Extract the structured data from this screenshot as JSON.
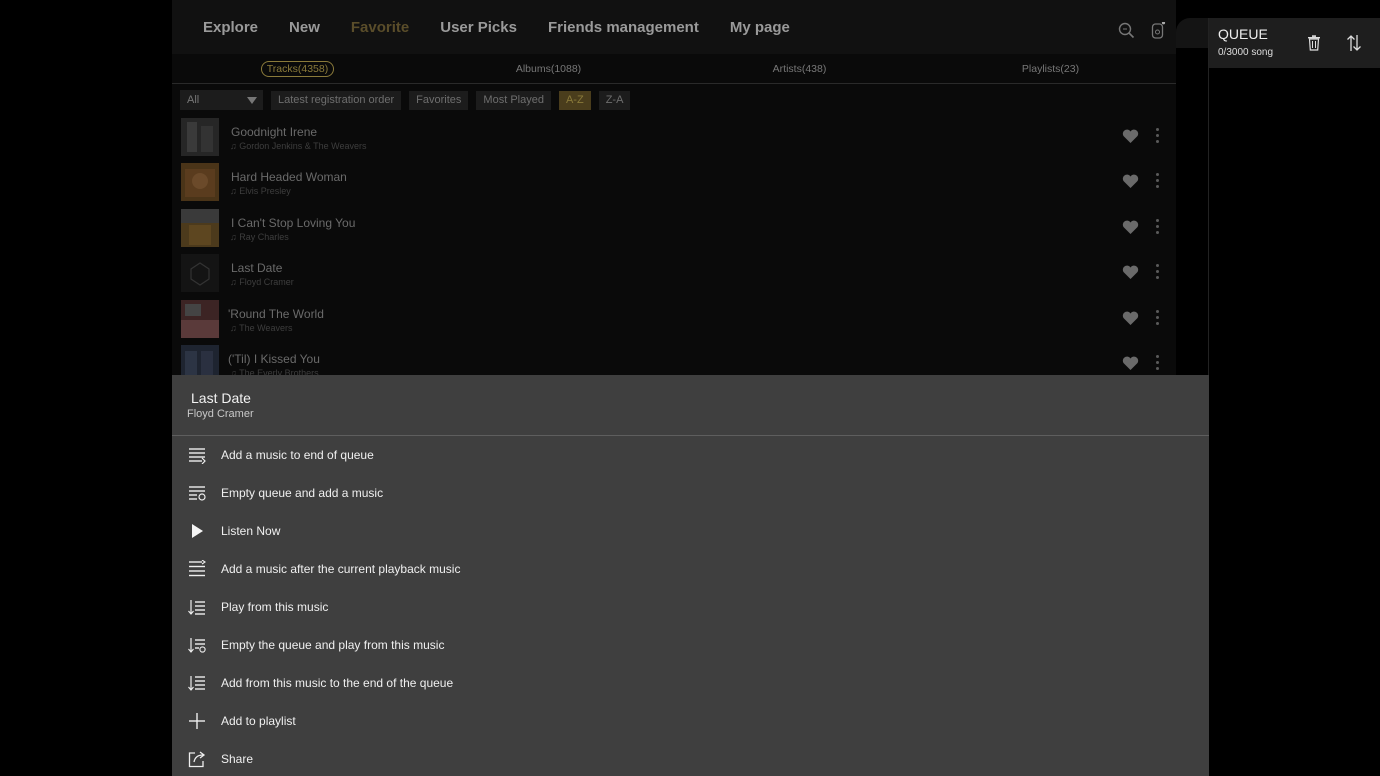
{
  "nav": {
    "items": [
      "Explore",
      "New",
      "Favorite",
      "User Picks",
      "Friends management",
      "My page"
    ],
    "active": "Favorite",
    "icons": [
      "search-icon",
      "device-icon"
    ]
  },
  "subtabs": [
    "Tracks(4358)",
    "Albums(1088)",
    "Artists(438)",
    "Playlists(23)"
  ],
  "filters": {
    "select_value": "All",
    "buttons": [
      "Latest registration order",
      "Favorites",
      "Most Played",
      "A-Z",
      "Z-A"
    ],
    "active": "A-Z"
  },
  "tracks": [
    {
      "title": "Goodnight Irene",
      "artist": "Gordon Jenkins & The Weavers"
    },
    {
      "title": "Hard Headed Woman",
      "artist": "Elvis Presley"
    },
    {
      "title": "I Can't Stop Loving You",
      "artist": "Ray Charles"
    },
    {
      "title": "Last Date",
      "artist": "Floyd Cramer"
    },
    {
      "title": "'Round The World",
      "artist": "The Weavers"
    },
    {
      "title": "('Til) I Kissed You",
      "artist": "The Everly Brothers"
    }
  ],
  "queue": {
    "title": "QUEUE",
    "count": "0/3000 song"
  },
  "sheet": {
    "title": "Last Date",
    "artist": "Floyd Cramer",
    "items": [
      {
        "label": "Add a music to end of queue",
        "icon": "queue-add-end-icon"
      },
      {
        "label": "Empty queue and add a music",
        "icon": "queue-empty-add-icon"
      },
      {
        "label": "Listen Now",
        "icon": "play-icon"
      },
      {
        "label": "Add a music after the current playback music",
        "icon": "queue-insert-next-icon"
      },
      {
        "label": "Play from this music",
        "icon": "play-from-icon"
      },
      {
        "label": "Empty the queue and play from this music",
        "icon": "empty-play-from-icon"
      },
      {
        "label": "Add from this music to the end of the queue",
        "icon": "add-from-end-icon"
      },
      {
        "label": "Add to playlist",
        "icon": "plus-icon"
      },
      {
        "label": "Share",
        "icon": "share-icon"
      }
    ]
  }
}
